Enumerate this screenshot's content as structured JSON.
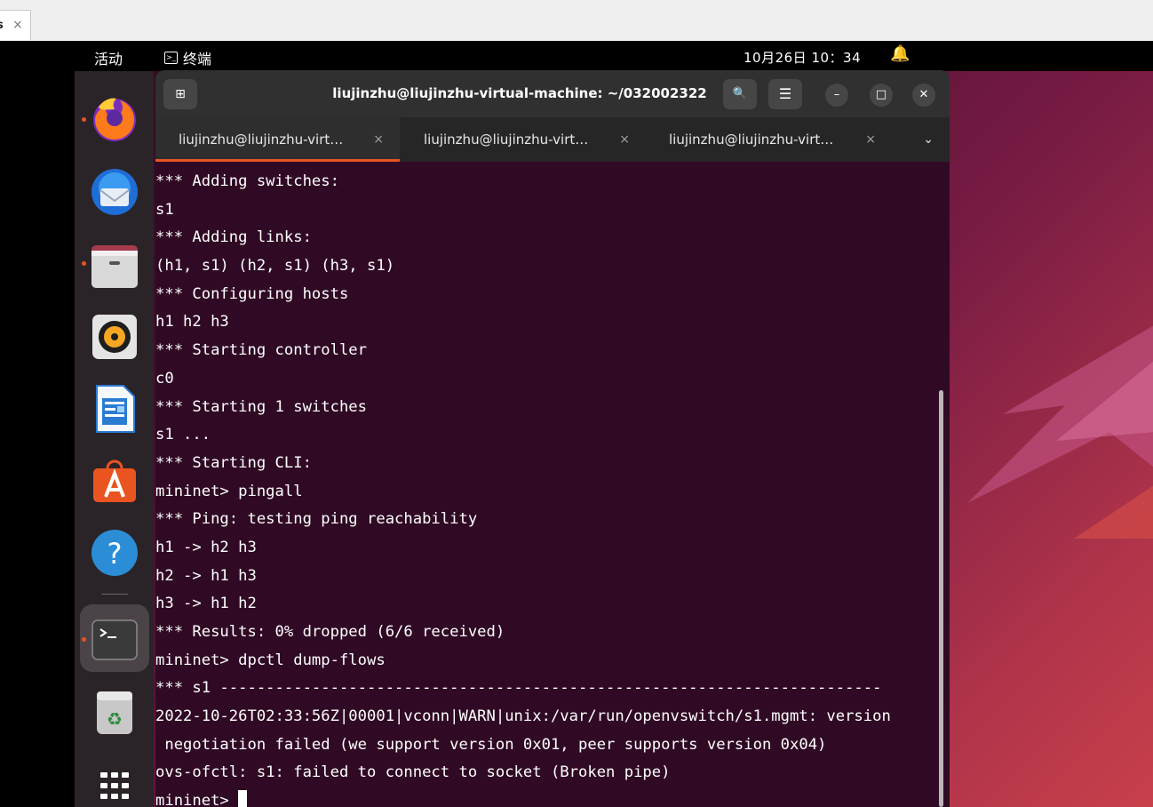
{
  "host_tab": {
    "title": "s",
    "close": "×"
  },
  "topbar": {
    "activities": "活动",
    "app_name": "终端",
    "app_icon": ">_",
    "clock": "10月26日  10：34",
    "bell": "🔔"
  },
  "dock": {
    "items": [
      {
        "name": "firefox-icon",
        "running": true
      },
      {
        "name": "thunderbird-icon",
        "running": false
      },
      {
        "name": "files-icon",
        "running": true
      },
      {
        "name": "rhythmbox-icon",
        "running": false
      },
      {
        "name": "writer-icon",
        "running": false
      },
      {
        "name": "app-center-icon",
        "running": false
      },
      {
        "name": "help-icon",
        "running": false
      },
      {
        "name": "terminal-icon",
        "running": true
      },
      {
        "name": "trash-icon",
        "running": false
      },
      {
        "name": "show-apps-icon",
        "running": false
      }
    ]
  },
  "terminal": {
    "title": "liujinzhu@liujinzhu-virtual-machine: ~/032002322",
    "new_tab_icon": "⊞",
    "search_icon": "🔍",
    "menu_icon": "☰",
    "minimize_icon": "–",
    "maximize_icon": "□",
    "close_icon": "✕",
    "tabs": [
      {
        "label": "liujinzhu@liujinzhu-virt…",
        "close": "×",
        "active": true
      },
      {
        "label": "liujinzhu@liujinzhu-virt…",
        "close": "×",
        "active": false
      },
      {
        "label": "liujinzhu@liujinzhu-virt…",
        "close": "×",
        "active": false
      }
    ],
    "tab_menu_icon": "⌄",
    "lines": [
      "*** Adding switches:",
      "s1",
      "*** Adding links:",
      "(h1, s1) (h2, s1) (h3, s1)",
      "*** Configuring hosts",
      "h1 h2 h3",
      "*** Starting controller",
      "c0",
      "*** Starting 1 switches",
      "s1 ...",
      "*** Starting CLI:",
      "mininet> pingall",
      "*** Ping: testing ping reachability",
      "h1 -> h2 h3",
      "h2 -> h1 h3",
      "h3 -> h1 h2",
      "*** Results: 0% dropped (6/6 received)",
      "mininet> dpctl dump-flows",
      "*** s1 ------------------------------------------------------------------------",
      "2022-10-26T02:33:56Z|00001|vconn|WARN|unix:/var/run/openvswitch/s1.mgmt: version",
      " negotiation failed (we support version 0x01, peer supports version 0x04)",
      "ovs-ofctl: s1: failed to connect to socket (Broken pipe)"
    ],
    "prompt": "mininet> "
  }
}
